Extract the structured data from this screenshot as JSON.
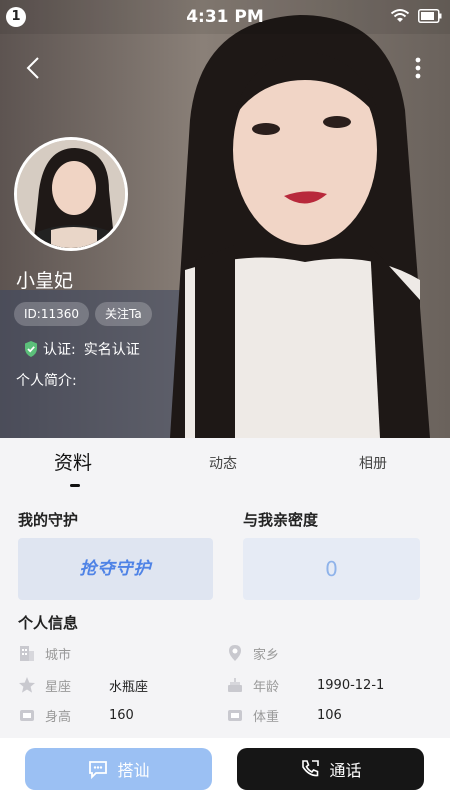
{
  "status_bar": {
    "notification_count": "1",
    "time": "4:31 PM"
  },
  "profile": {
    "nickname": "小皇妃",
    "id_chip": "ID:11360",
    "follow_chip": "关注Ta",
    "cert_label": "认证:",
    "cert_value": "实名认证",
    "bio_label": "个人简介:"
  },
  "tabs": [
    {
      "label": "资料",
      "active": true
    },
    {
      "label": "动态",
      "active": false
    },
    {
      "label": "相册",
      "active": false
    }
  ],
  "guard": {
    "title": "我的守护",
    "button_label": "抢夺守护"
  },
  "intimacy": {
    "title": "与我亲密度",
    "value": "0"
  },
  "personal_info": {
    "title": "个人信息",
    "fields": [
      {
        "label": "城市",
        "value": "",
        "icon": "building-icon"
      },
      {
        "label": "家乡",
        "value": "",
        "icon": "location-pin-icon"
      },
      {
        "label": "星座",
        "value": "水瓶座",
        "icon": "star-icon"
      },
      {
        "label": "年龄",
        "value": "1990-12-1",
        "icon": "cake-icon"
      },
      {
        "label": "身高",
        "value": "160",
        "icon": "ruler-icon"
      },
      {
        "label": "体重",
        "value": "106",
        "icon": "scale-icon"
      }
    ]
  },
  "actions": {
    "chat_label": "搭讪",
    "call_label": "通话"
  },
  "colors": {
    "accent_blue": "#4f83e6",
    "chat_button": "#9bc0f3",
    "call_button": "#161616",
    "panel_bg": "#f4f4f6"
  }
}
